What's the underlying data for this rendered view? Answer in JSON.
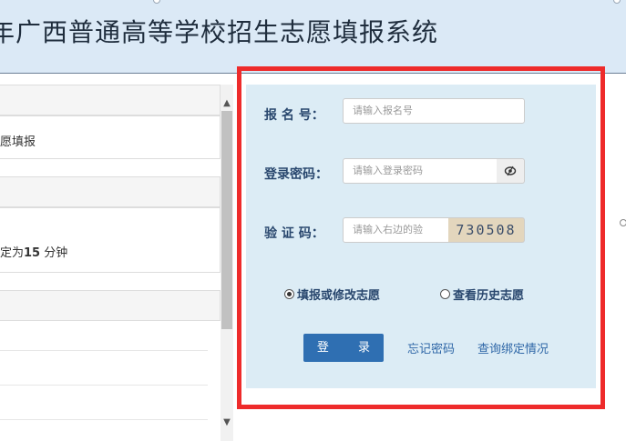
{
  "header": {
    "title": "年广西普通高等学校招生志愿填报系统"
  },
  "left_panel": {
    "item_fill": "愿填报",
    "duration_prefix": "定为",
    "duration_value": "15",
    "duration_unit": " 分钟"
  },
  "login": {
    "reg_label": "报 名 号：",
    "reg_placeholder": "请输入报名号",
    "pwd_label": "登录密码：",
    "pwd_placeholder": "请输入登录密码",
    "captcha_label": "验 证 码：",
    "captcha_placeholder": "请输入右边的验",
    "captcha_code": "730508",
    "radio_fill": "填报或修改志愿",
    "radio_history": "查看历史志愿",
    "radio_fill_checked": true,
    "login_button": "登 录",
    "forgot_link": "忘记密码",
    "binding_link": "查询绑定情况"
  },
  "colors": {
    "header_bg": "#dbe9f6",
    "panel_bg": "#dcecf5",
    "label": "#29476e",
    "button": "#2f6fb2",
    "highlight": "#ee2b2b"
  },
  "icons": {
    "eye": "eye-toggle-icon"
  }
}
